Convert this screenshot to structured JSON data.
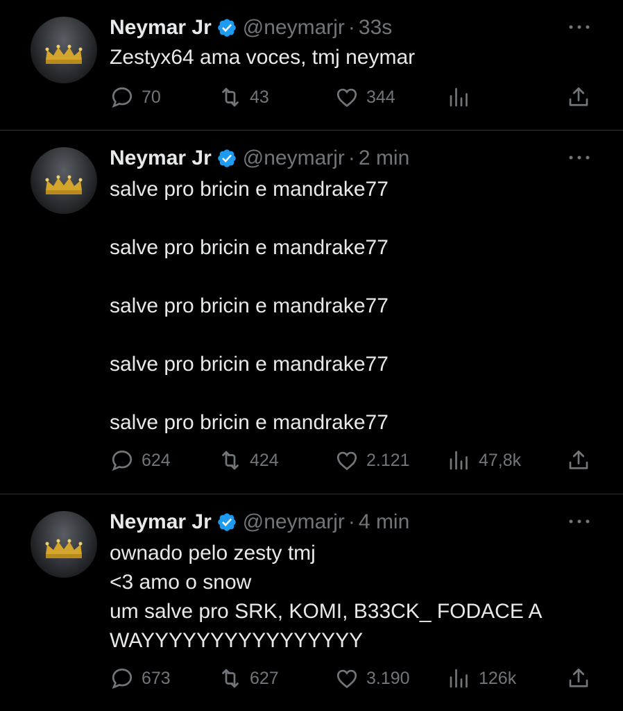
{
  "tweets": [
    {
      "author": "Neymar Jr",
      "handle": "@neymarjr",
      "separator": "·",
      "time": "33s",
      "text": "Zestyx64 ama voces, tmj neymar",
      "replies": "70",
      "retweets": "43",
      "likes": "344",
      "views": ""
    },
    {
      "author": "Neymar Jr",
      "handle": "@neymarjr",
      "separator": "·",
      "time": "2 min",
      "text": "salve pro bricin e mandrake77\n\nsalve pro bricin e mandrake77\n\nsalve pro bricin e mandrake77\n\nsalve pro bricin e mandrake77\n\nsalve pro bricin e mandrake77",
      "replies": "624",
      "retweets": "424",
      "likes": "2.121",
      "views": "47,8k"
    },
    {
      "author": "Neymar Jr",
      "handle": "@neymarjr",
      "separator": "·",
      "time": "4 min",
      "text": "ownado pelo zesty tmj\n<3 amo o snow\num salve pro SRK, KOMI, B33CK_ FODACE A\nWAYYYYYYYYYYYYYYYY",
      "replies": "673",
      "retweets": "627",
      "likes": "3.190",
      "views": "126k"
    }
  ],
  "colors": {
    "background": "#000000",
    "text": "#e7e9ea",
    "secondary": "#71767b",
    "verified": "#1d9bf0",
    "divider": "#2f3336"
  },
  "icons": [
    "more-icon",
    "verified-badge-icon",
    "reply-icon",
    "retweet-icon",
    "like-icon",
    "views-icon",
    "share-icon",
    "crown-avatar"
  ]
}
